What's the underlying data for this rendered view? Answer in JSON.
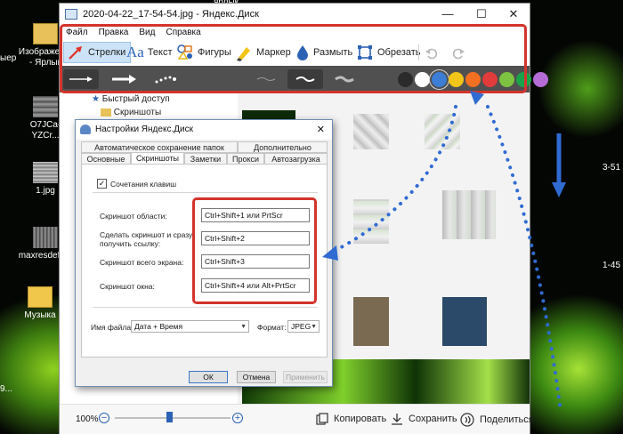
{
  "desktop": {
    "icons": [
      {
        "label": "Изображен... - Ярлык"
      },
      {
        "label": "O7JCa-YZCr..."
      },
      {
        "label": "1.jpg"
      },
      {
        "label": "maxresdefa..."
      },
      {
        "label": "Музыка"
      }
    ],
    "partial_labels": [
      "ыер",
      "ярлык",
      "3-51",
      "1-45",
      "9..."
    ]
  },
  "editor": {
    "title": "2020-04-22_17-54-54.jpg - Яндекс.Диск",
    "window_controls": {
      "minimize": "—",
      "maximize": "☐",
      "close": "✕"
    },
    "menu": [
      "Файл",
      "Правка",
      "Вид",
      "Справка"
    ],
    "tools": [
      {
        "label": "Стрелки",
        "icon": "arrow-tool-icon",
        "active": true
      },
      {
        "label": "Текст",
        "icon": "text-tool-icon",
        "active": false
      },
      {
        "label": "Фигуры",
        "icon": "shapes-tool-icon",
        "active": false
      },
      {
        "label": "Маркер",
        "icon": "marker-tool-icon",
        "active": false
      },
      {
        "label": "Размыть",
        "icon": "blur-tool-icon",
        "active": false
      },
      {
        "label": "Обрезать",
        "icon": "crop-tool-icon",
        "active": false
      }
    ],
    "text_tool_glyph": "Aa",
    "colors": {
      "accent_red": "#d3342b",
      "swatches": [
        "#2b2b2b",
        "#ffffff",
        "#3c7dd6",
        "#f0c419",
        "#f36f21",
        "#e23b3b",
        "#7dc241",
        "#1aa34a",
        "#b56cd6"
      ],
      "selected_swatch": 2
    },
    "zoom": "100%",
    "zoom_fraction": 0.47,
    "zoom_out_symbol": "−",
    "zoom_in_symbol": "+",
    "footer": {
      "copy": "Копировать",
      "save": "Сохранить",
      "share": "Поделиться"
    },
    "explorer": {
      "quick_access": "Быстрый доступ",
      "screenshots": "Скриншоты"
    }
  },
  "dialog": {
    "title": "Настройки Яндекс.Диск",
    "close": "✕",
    "tabs_row1": [
      "Автоматическое сохранение папок",
      "Дополнительно"
    ],
    "tabs_row2": [
      "Основные",
      "Скриншоты",
      "Заметки",
      "Прокси",
      "Автозагрузка"
    ],
    "active_tab": "Скриншоты",
    "checkbox_label": "Сочетания клавиш",
    "checkbox_checked": true,
    "checkbox_mark": "✓",
    "shortcuts": [
      {
        "label": "Скриншот области:",
        "value": "Ctrl+Shift+1 или PrtScr"
      },
      {
        "label": "Сделать скриншот и сразу получить ссылку:",
        "value": "Ctrl+Shift+2"
      },
      {
        "label": "Скриншот всего экрана:",
        "value": "Ctrl+Shift+3"
      },
      {
        "label": "Скриншот окна:",
        "value": "Ctrl+Shift+4 или Alt+PrtScr"
      }
    ],
    "filename_label": "Имя файла:",
    "filename_value": "Дата + Время",
    "format_label": "Формат:",
    "format_value": "JPEG",
    "buttons": {
      "ok": "ОК",
      "cancel": "Отмена",
      "apply": "Применить"
    }
  }
}
